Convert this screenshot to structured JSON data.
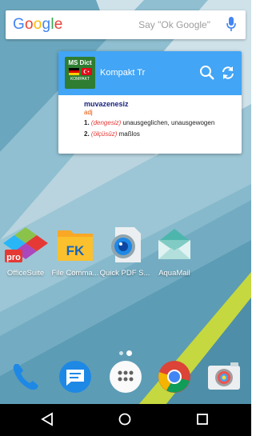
{
  "search": {
    "logo_letters": [
      "G",
      "o",
      "o",
      "g",
      "l",
      "e"
    ],
    "logo_colors": [
      "#4285F4",
      "#EA4335",
      "#FBBC05",
      "#4285F4",
      "#34A853",
      "#EA4335"
    ],
    "hint": "Say \"Ok Google\"",
    "mic_icon": "mic-icon"
  },
  "widget": {
    "logo_line1": "MS Dict",
    "logo_line2": "KOMPAKT",
    "title": "Kompakt Tr",
    "header_color": "#42a5f5",
    "icons": [
      "search-icon",
      "sync-icon"
    ],
    "entry": {
      "word": "muvazenesiz",
      "pos": "adj",
      "senses": [
        {
          "num": "1.",
          "tr": "(dengesiz)",
          "text": "unausgeglichen, unausgewogen"
        },
        {
          "num": "2.",
          "tr": "(ölçüsüz)",
          "text": "maßlos"
        }
      ]
    }
  },
  "apps": [
    {
      "label": "OfficeSuite",
      "icon": "officesuite-icon"
    },
    {
      "label": "File Comma...",
      "icon": "file-commander-icon"
    },
    {
      "label": "Quick PDF S...",
      "icon": "quick-pdf-scanner-icon"
    },
    {
      "label": "AquaMail",
      "icon": "aquamail-icon"
    }
  ],
  "page_indicator": {
    "pages": 2,
    "active": 2
  },
  "dock": [
    "phone-icon",
    "messages-icon",
    "app-drawer-icon",
    "chrome-icon",
    "camera-icon"
  ],
  "navbar": [
    "back-icon",
    "home-icon",
    "recents-icon"
  ]
}
